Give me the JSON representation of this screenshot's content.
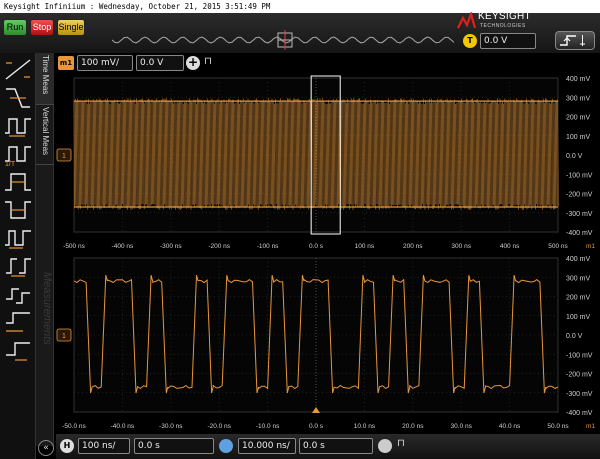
{
  "window": {
    "title": "Keysight Infiniium : Wednesday, October 21, 2015 3:51:49 PM"
  },
  "toolbar": {
    "run_label": "Run",
    "stop_label": "Stop",
    "single_label": "Single"
  },
  "brand": {
    "name": "KEYSIGHT",
    "tagline": "TECHNOLOGIES"
  },
  "trigger": {
    "badge": "T",
    "level": "0.0 V"
  },
  "channel": {
    "badge": "m1",
    "scale": "100 mV/",
    "offset": "0.0 V",
    "ref_marker": "1"
  },
  "side_tabs": {
    "time_meas": "Time Meas",
    "vertical_meas": "Vertical Meas",
    "measurements": "Measurements"
  },
  "horizontal": {
    "badge": "H",
    "scale": "100 ns/",
    "position": "0.0 s",
    "zoom_scale": "10.000 ns/",
    "zoom_position": "0.0 s"
  },
  "colors": {
    "trace": "#e8963a",
    "grid": "#2a2a2a",
    "axis_text": "#cfcfcf",
    "accent": "#f4c800"
  },
  "chart_data": [
    {
      "type": "line",
      "title": "",
      "series_label": "m1",
      "x_ticks": [
        "-500 ns",
        "-400 ns",
        "-300 ns",
        "-200 ns",
        "-100 ns",
        "0.0 s",
        "100 ns",
        "200 ns",
        "300 ns",
        "400 ns",
        "500 ns"
      ],
      "y_ticks": [
        "400 mV",
        "300 mV",
        "200 mV",
        "100 mV",
        "0.0 V",
        "-100 mV",
        "-200 mV",
        "-300 mV",
        "-400 mV"
      ],
      "xlim_ns": [
        -500,
        500
      ],
      "ylim_mV": [
        -400,
        400
      ],
      "signal": {
        "high_mV": 280,
        "low_mV": -270,
        "bit_period_ns": 3.333
      },
      "zoom_window_ns": [
        -10,
        50
      ]
    },
    {
      "type": "line",
      "title": "",
      "series_label": "m1",
      "x_ticks": [
        "-50.0 ns",
        "-40.0 ns",
        "-30.0 ns",
        "-20.0 ns",
        "-10.0 ns",
        "0.0 s",
        "10.0 ns",
        "20.0 ns",
        "30.0 ns",
        "40.0 ns",
        "50.0 ns"
      ],
      "y_ticks": [
        "400 mV",
        "300 mV",
        "200 mV",
        "100 mV",
        "0.0 V",
        "-100 mV",
        "-200 mV",
        "-300 mV",
        "-400 mV"
      ],
      "xlim_ns": [
        -50,
        50
      ],
      "ylim_mV": [
        -400,
        400
      ],
      "bits": [
        1,
        0,
        1,
        1,
        0,
        1,
        0,
        0,
        1,
        0,
        1,
        1,
        0,
        1,
        0,
        1,
        1,
        0,
        0,
        1,
        0,
        1,
        0,
        1,
        1,
        0,
        1,
        0,
        0,
        1,
        1,
        0
      ]
    }
  ]
}
